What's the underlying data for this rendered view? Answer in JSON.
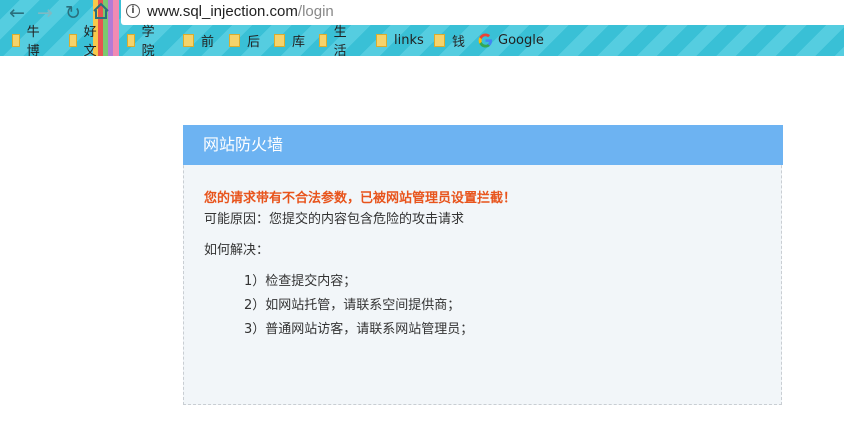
{
  "browser": {
    "url_host": "www.sql_injection.com",
    "url_path": "/login",
    "bookmarks": [
      {
        "label": "牛博",
        "type": "folder"
      },
      {
        "label": "好文",
        "type": "folder"
      },
      {
        "label": "学院",
        "type": "folder"
      },
      {
        "label": "前",
        "type": "folder"
      },
      {
        "label": "后",
        "type": "folder"
      },
      {
        "label": "库",
        "type": "folder"
      },
      {
        "label": "生活",
        "type": "folder"
      },
      {
        "label": "links",
        "type": "folder"
      },
      {
        "label": "钱",
        "type": "folder"
      },
      {
        "label": "Google",
        "type": "site"
      }
    ],
    "icons": [
      "back-icon",
      "forward-icon",
      "reload-icon",
      "home-icon",
      "info-icon"
    ]
  },
  "firewall": {
    "title": "网站防火墙",
    "alert": "您的请求带有不合法参数，已被网站管理员设置拦截！",
    "reason": "可能原因：您提交的内容包含危险的攻击请求",
    "how_to": "如何解决：",
    "steps": [
      "1）检查提交内容；",
      "2）如网站托管，请联系空间提供商；",
      "3）普通网站访客，请联系网站管理员；"
    ]
  },
  "colors": {
    "header": "#6db3f2",
    "alert": "#e8541c",
    "panel_bg": "#f2f6f9"
  }
}
